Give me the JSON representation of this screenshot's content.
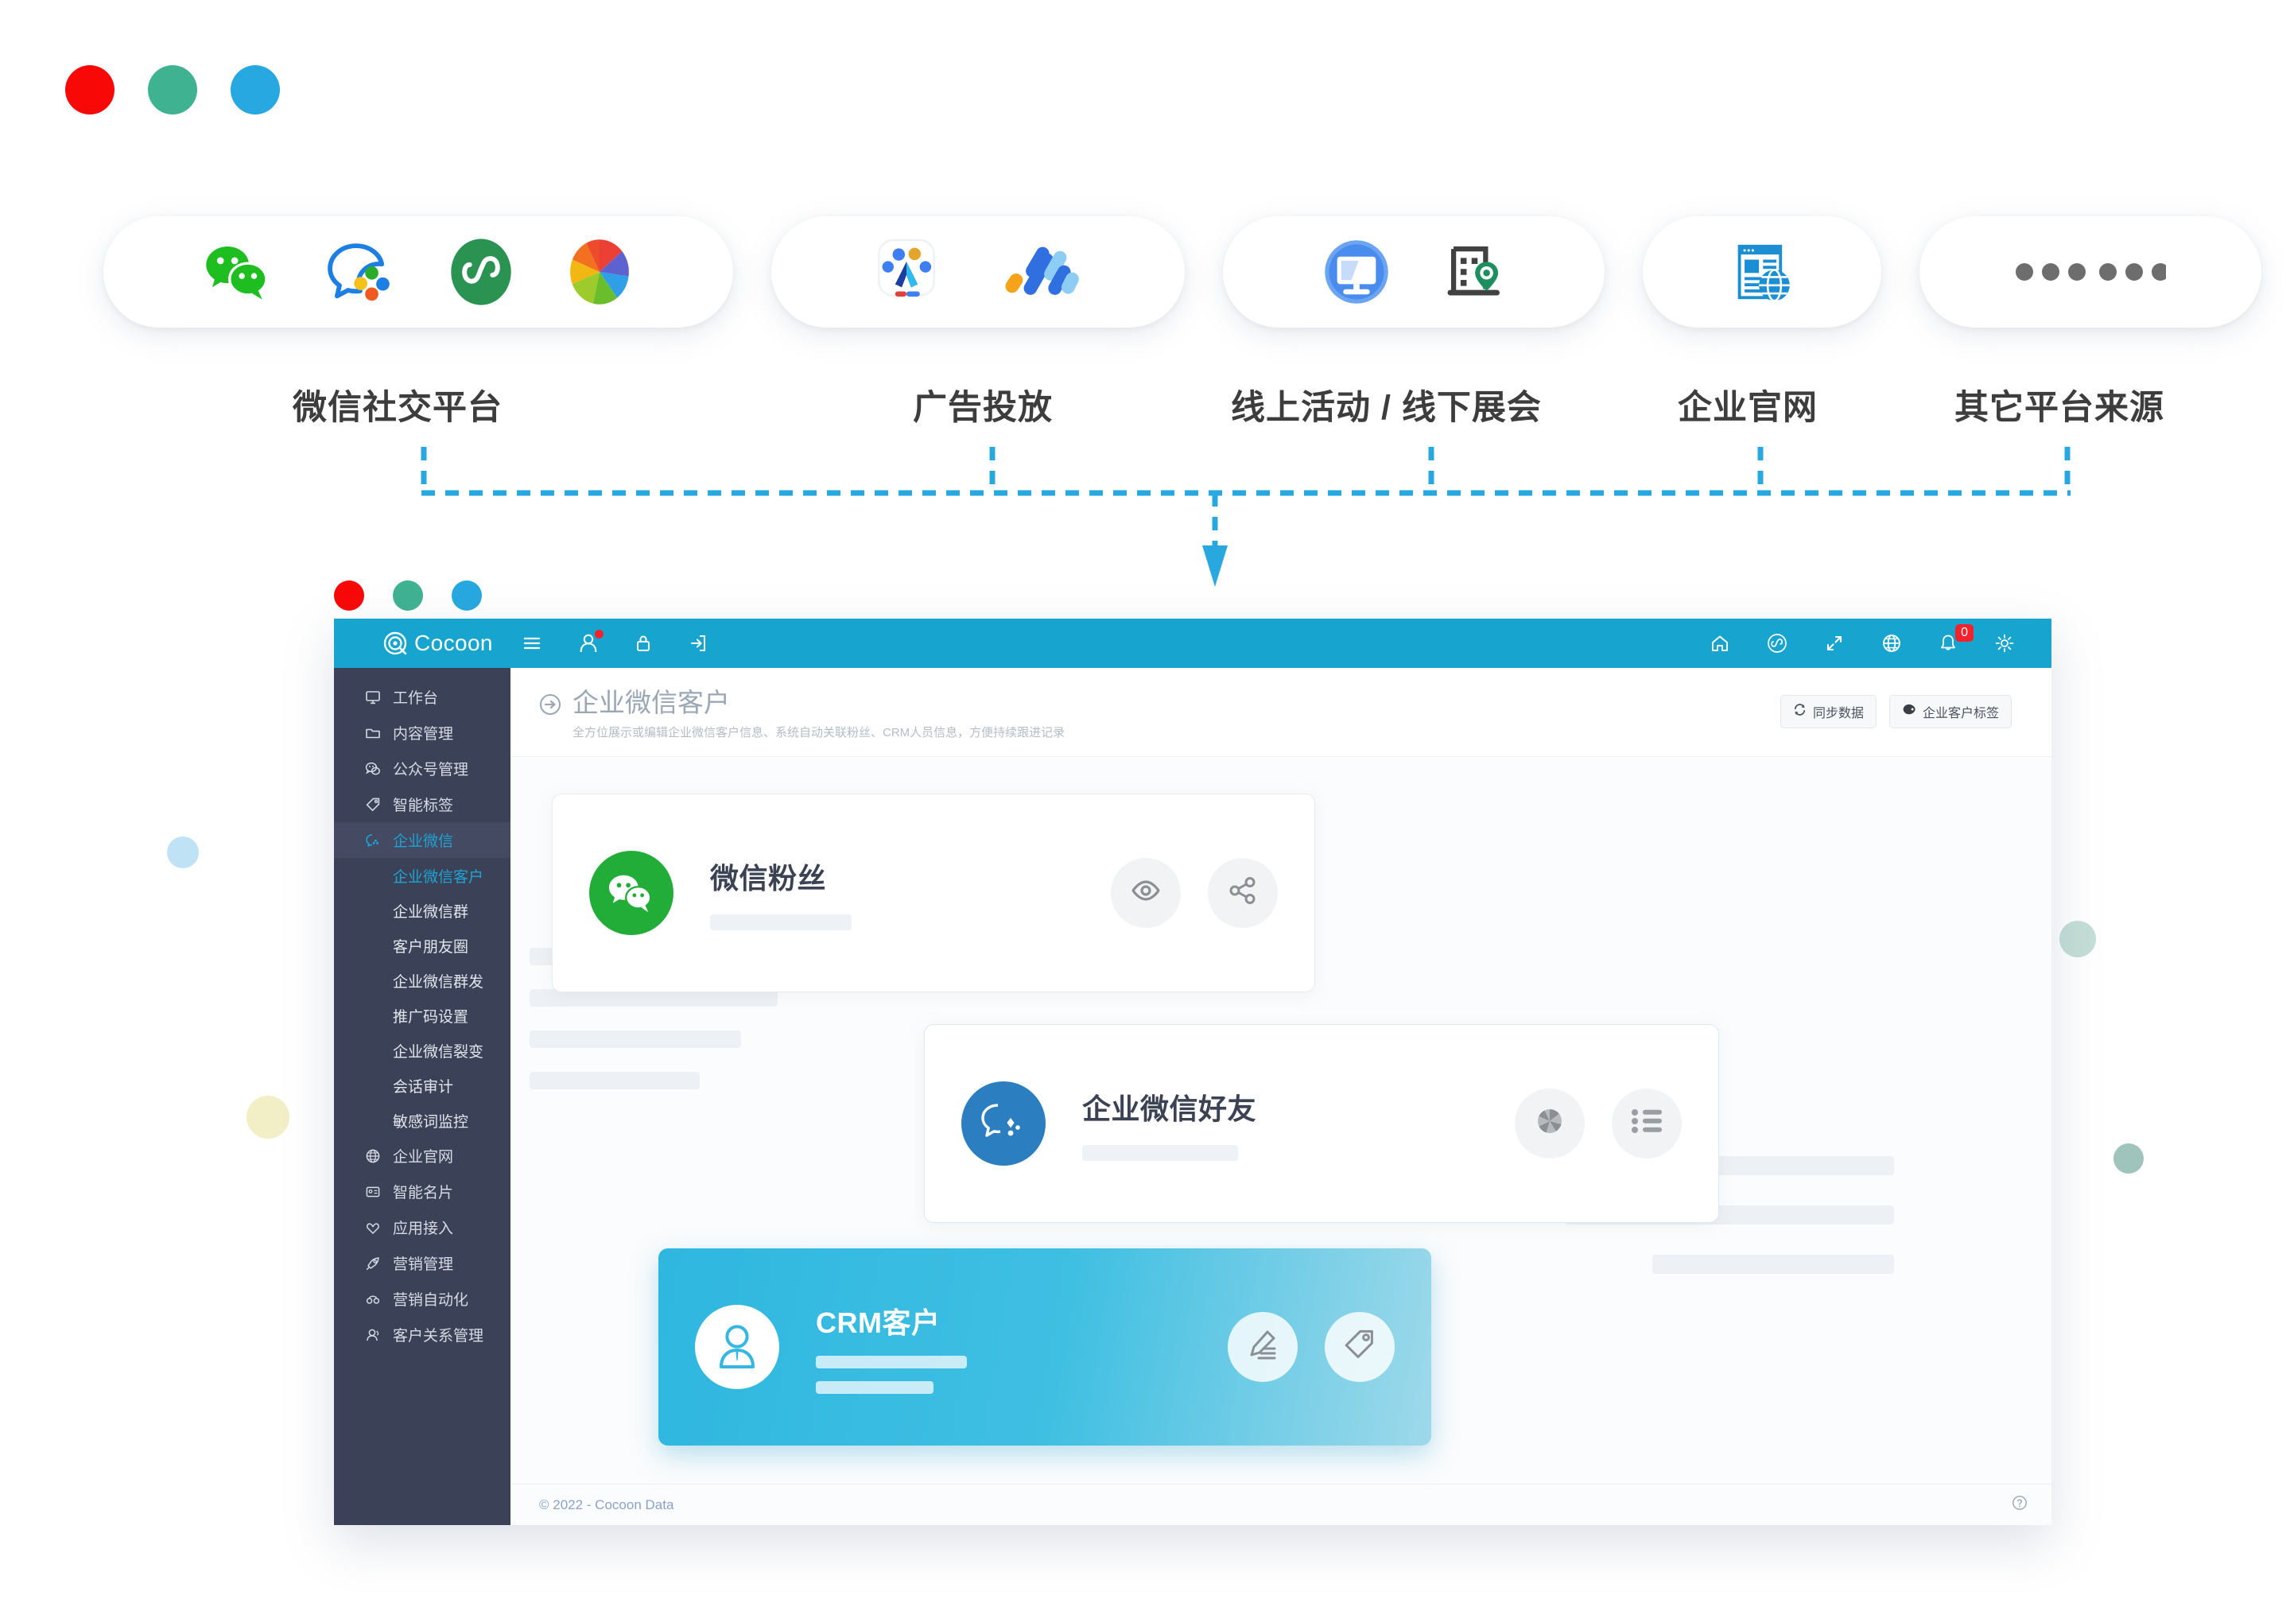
{
  "theme": {
    "accent": "#17a5cf",
    "sidebar_bg": "#3b4257",
    "active_blue": "#1fa3d4",
    "wechat_green": "#22ac38",
    "wecom_blue": "#2b7fc0",
    "badge_red": "#f5222d"
  },
  "traffic_dots": [
    {
      "name": "close",
      "color": "#f90808"
    },
    {
      "name": "minimize",
      "color": "#3fb292"
    },
    {
      "name": "maximize",
      "color": "#27a8e0"
    }
  ],
  "sources": {
    "groups": [
      {
        "label": "微信社交平台",
        "icons": [
          "wechat-icon",
          "wecom-icon",
          "miniprogram-icon",
          "channels-icon"
        ]
      },
      {
        "label": "广告投放",
        "icons": [
          "baidu-ads-icon",
          "juliang-ads-icon"
        ]
      },
      {
        "label": "线上活动 / 线下展会",
        "icons": [
          "online-event-icon",
          "offline-expo-icon"
        ]
      },
      {
        "label": "企业官网",
        "icons": [
          "website-icon"
        ]
      },
      {
        "label": "其它平台来源",
        "icons": [
          "ellipsis-icon"
        ]
      }
    ]
  },
  "app": {
    "window_dots": [
      {
        "name": "close",
        "color": "#f90808"
      },
      {
        "name": "minimize",
        "color": "#3fb292"
      },
      {
        "name": "maximize",
        "color": "#27a8e0"
      }
    ],
    "header": {
      "logo_text": "Cocoon",
      "left_icons": [
        {
          "name": "menu-icon",
          "glyph": "≡"
        },
        {
          "name": "user-icon",
          "badge_dot": true
        },
        {
          "name": "lock-icon"
        },
        {
          "name": "login-icon"
        }
      ],
      "right_icons": [
        {
          "name": "home-icon"
        },
        {
          "name": "miniprogram-icon"
        },
        {
          "name": "expand-icon"
        },
        {
          "name": "globe-icon"
        },
        {
          "name": "bell-icon",
          "badge": "0"
        },
        {
          "name": "gear-icon"
        }
      ]
    },
    "sidebar": {
      "items": [
        {
          "label": "工作台",
          "icon": "desktop-icon",
          "active": false
        },
        {
          "label": "内容管理",
          "icon": "folder-icon",
          "active": false
        },
        {
          "label": "公众号管理",
          "icon": "wechat-chat-icon",
          "active": false
        },
        {
          "label": "智能标签",
          "icon": "tag-icon",
          "active": false
        },
        {
          "label": "企业微信",
          "icon": "wecom-chat-icon",
          "active": true
        }
      ],
      "subitems": [
        {
          "label": "企业微信客户",
          "active": true
        },
        {
          "label": "企业微信群",
          "active": false
        },
        {
          "label": "客户朋友圈",
          "active": false
        },
        {
          "label": "企业微信群发",
          "active": false
        },
        {
          "label": "推广码设置",
          "active": false
        },
        {
          "label": "企业微信裂变",
          "active": false
        },
        {
          "label": "会话审计",
          "active": false
        },
        {
          "label": "敏感词监控",
          "active": false
        }
      ],
      "items_tail": [
        {
          "label": "企业官网",
          "icon": "globe-icon",
          "active": false
        },
        {
          "label": "智能名片",
          "icon": "card-icon",
          "active": false
        },
        {
          "label": "应用接入",
          "icon": "plug-icon",
          "active": false
        },
        {
          "label": "营销管理",
          "icon": "rocket-icon",
          "active": false
        },
        {
          "label": "营销自动化",
          "icon": "automation-icon",
          "active": false
        },
        {
          "label": "客户关系管理",
          "icon": "users-icon",
          "active": false
        }
      ]
    },
    "page": {
      "title": "企业微信客户",
      "subtitle": "全方位展示或编辑企业微信客户信息、系统自动关联粉丝、CRM人员信息，方便持续跟进记录",
      "actions": [
        {
          "label": "同步数据",
          "icon": "sync-icon"
        },
        {
          "label": "企业客户标签",
          "icon": "tag-icon"
        }
      ]
    },
    "cards": [
      {
        "title": "微信粉丝",
        "avatar_icon": "wechat-icon",
        "avatar_color": "#22ac38",
        "actions": [
          "eye-icon",
          "share-icon"
        ]
      },
      {
        "title": "企业微信好友",
        "avatar_icon": "wecom-icon",
        "avatar_color": "#2b7fc0",
        "actions": [
          "aperture-icon",
          "list-icon"
        ]
      },
      {
        "title": "CRM客户",
        "avatar_icon": "person-tie-icon",
        "avatar_color": "#ffffff",
        "actions": [
          "edit-icon",
          "price-tag-icon"
        ]
      }
    ],
    "footer": {
      "copyright": "© 2022 - Cocoon Data",
      "help_icon": "help-icon"
    }
  }
}
